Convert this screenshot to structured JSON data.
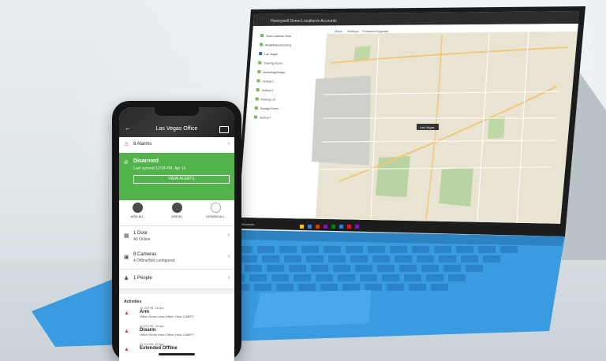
{
  "laptop": {
    "title_bar": "Honeywell Demo Location/s Accounts",
    "tabs": [
      "Maps",
      "Settings",
      "Firmware/Upgrade"
    ],
    "tree_items": [
      "Sub/Locations Vista",
      "Retail/Manufacturing",
      "Las Vegas",
      "Training Room",
      "Marketing/Design",
      "Vertical 1",
      "Vertical 2",
      "Parking Lot",
      "Storage Room",
      "Vertical 7"
    ],
    "map_marker_label": "Las Vegas",
    "taskbar_label": "Windows"
  },
  "phone": {
    "title": "Las Vegas Office",
    "alarms": "8 Alarms",
    "status": {
      "title": "Disarmed",
      "subtitle": "Last synced 12:04 PM, Apr 16",
      "button": "VIEW ALERTS"
    },
    "arm_controls": [
      {
        "label": "ARM ALL"
      },
      {
        "label": "AREAS"
      },
      {
        "label": "DISARM ALL"
      }
    ],
    "doors": {
      "title": "1 Door",
      "subtitle": "All Online"
    },
    "cameras": {
      "title": "8 Cameras",
      "subtitle": "4 Offline/Not configured"
    },
    "people": {
      "title": "1 People"
    },
    "activities_title": "Activities",
    "activities": [
      {
        "time": "12:03 PM, 16 Apr",
        "name": "Arm",
        "detail": "Office Demo Area,Office Vista-128BPT"
      },
      {
        "time": "12:03 PM, 16 Apr",
        "name": "Disarm",
        "detail": "Office Demo Area,Office Vista-128BPT"
      },
      {
        "time": "01:44 AM, 16 Apr",
        "name": "Extended Offline",
        "detail": ""
      }
    ]
  },
  "colors": {
    "status_green": "#52b34d",
    "alarm_red": "#d9453b",
    "keyboard_blue": "#3a9be0"
  }
}
